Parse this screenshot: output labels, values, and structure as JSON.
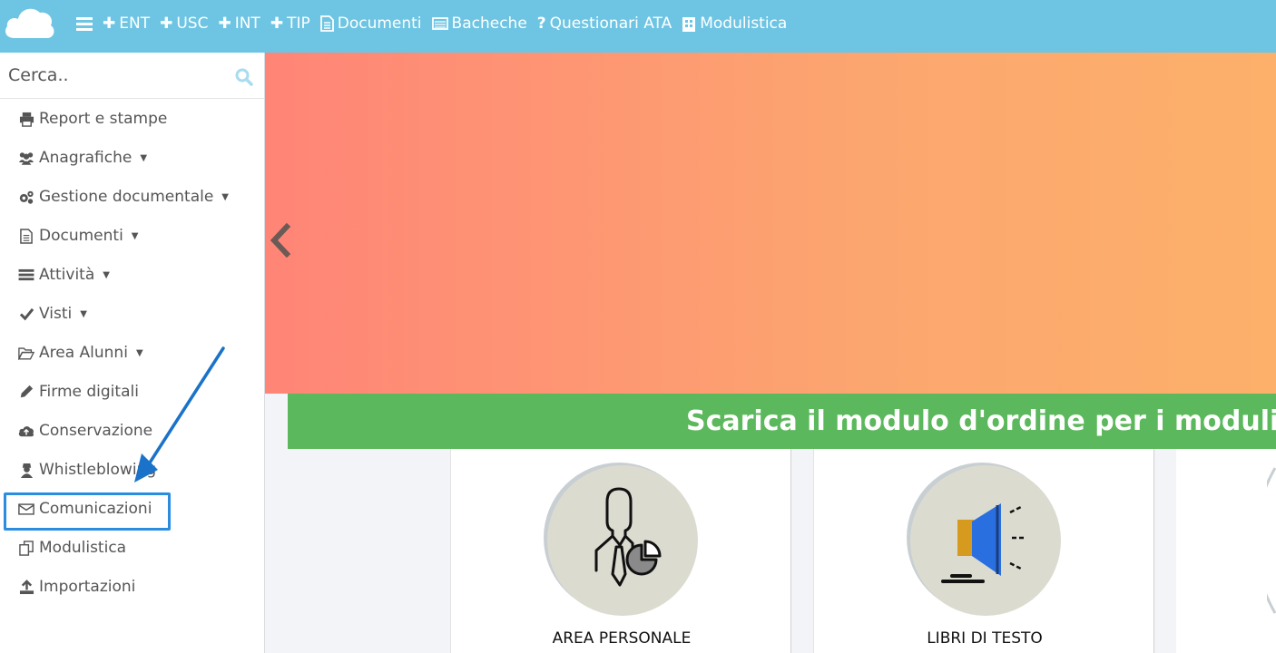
{
  "topbar": {
    "nav": [
      {
        "icon": "menu-icon",
        "label": ""
      },
      {
        "icon": "plus-icon",
        "label": "ENT"
      },
      {
        "icon": "plus-icon",
        "label": "USC"
      },
      {
        "icon": "plus-icon",
        "label": "INT"
      },
      {
        "icon": "plus-icon",
        "label": "TIP"
      },
      {
        "icon": "document-icon",
        "label": "Documenti"
      },
      {
        "icon": "board-icon",
        "label": "Bacheche"
      },
      {
        "icon": "question-icon",
        "label": "Questionari ATA"
      },
      {
        "icon": "building-icon",
        "label": "Modulistica"
      }
    ]
  },
  "sidebar": {
    "search_placeholder": "Cerca..",
    "items": [
      {
        "icon": "print-icon",
        "label": "Report e stampe",
        "caret": false
      },
      {
        "icon": "users-icon",
        "label": "Anagrafiche",
        "caret": true
      },
      {
        "icon": "gears-icon",
        "label": "Gestione documentale",
        "caret": true
      },
      {
        "icon": "document-icon",
        "label": "Documenti",
        "caret": true
      },
      {
        "icon": "list-icon",
        "label": "Attività",
        "caret": true
      },
      {
        "icon": "check-icon",
        "label": "Visti",
        "caret": true
      },
      {
        "icon": "folder-open-icon",
        "label": "Area Alunni",
        "caret": true
      },
      {
        "icon": "pencil-icon",
        "label": "Firme digitali",
        "caret": false
      },
      {
        "icon": "cloud-upload-icon",
        "label": "Conservazione",
        "caret": false
      },
      {
        "icon": "user-secret-icon",
        "label": "Whistleblowing",
        "caret": false
      },
      {
        "icon": "envelope-icon",
        "label": "Comunicazioni",
        "caret": false
      },
      {
        "icon": "copy-icon",
        "label": "Modulistica",
        "caret": false
      },
      {
        "icon": "upload-icon",
        "label": "Importazioni",
        "caret": false
      }
    ]
  },
  "main": {
    "banner_text": "Scarica il modulo d'ordine per i moduli di Nuvo",
    "cards": [
      {
        "icon": "personal-area-icon",
        "label": "AREA PERSONALE"
      },
      {
        "icon": "megaphone-icon",
        "label": "LIBRI DI TESTO"
      }
    ]
  },
  "colors": {
    "topbar": "#6dc5e3",
    "accent": "#2a8de0",
    "green": "#5cb85c"
  }
}
